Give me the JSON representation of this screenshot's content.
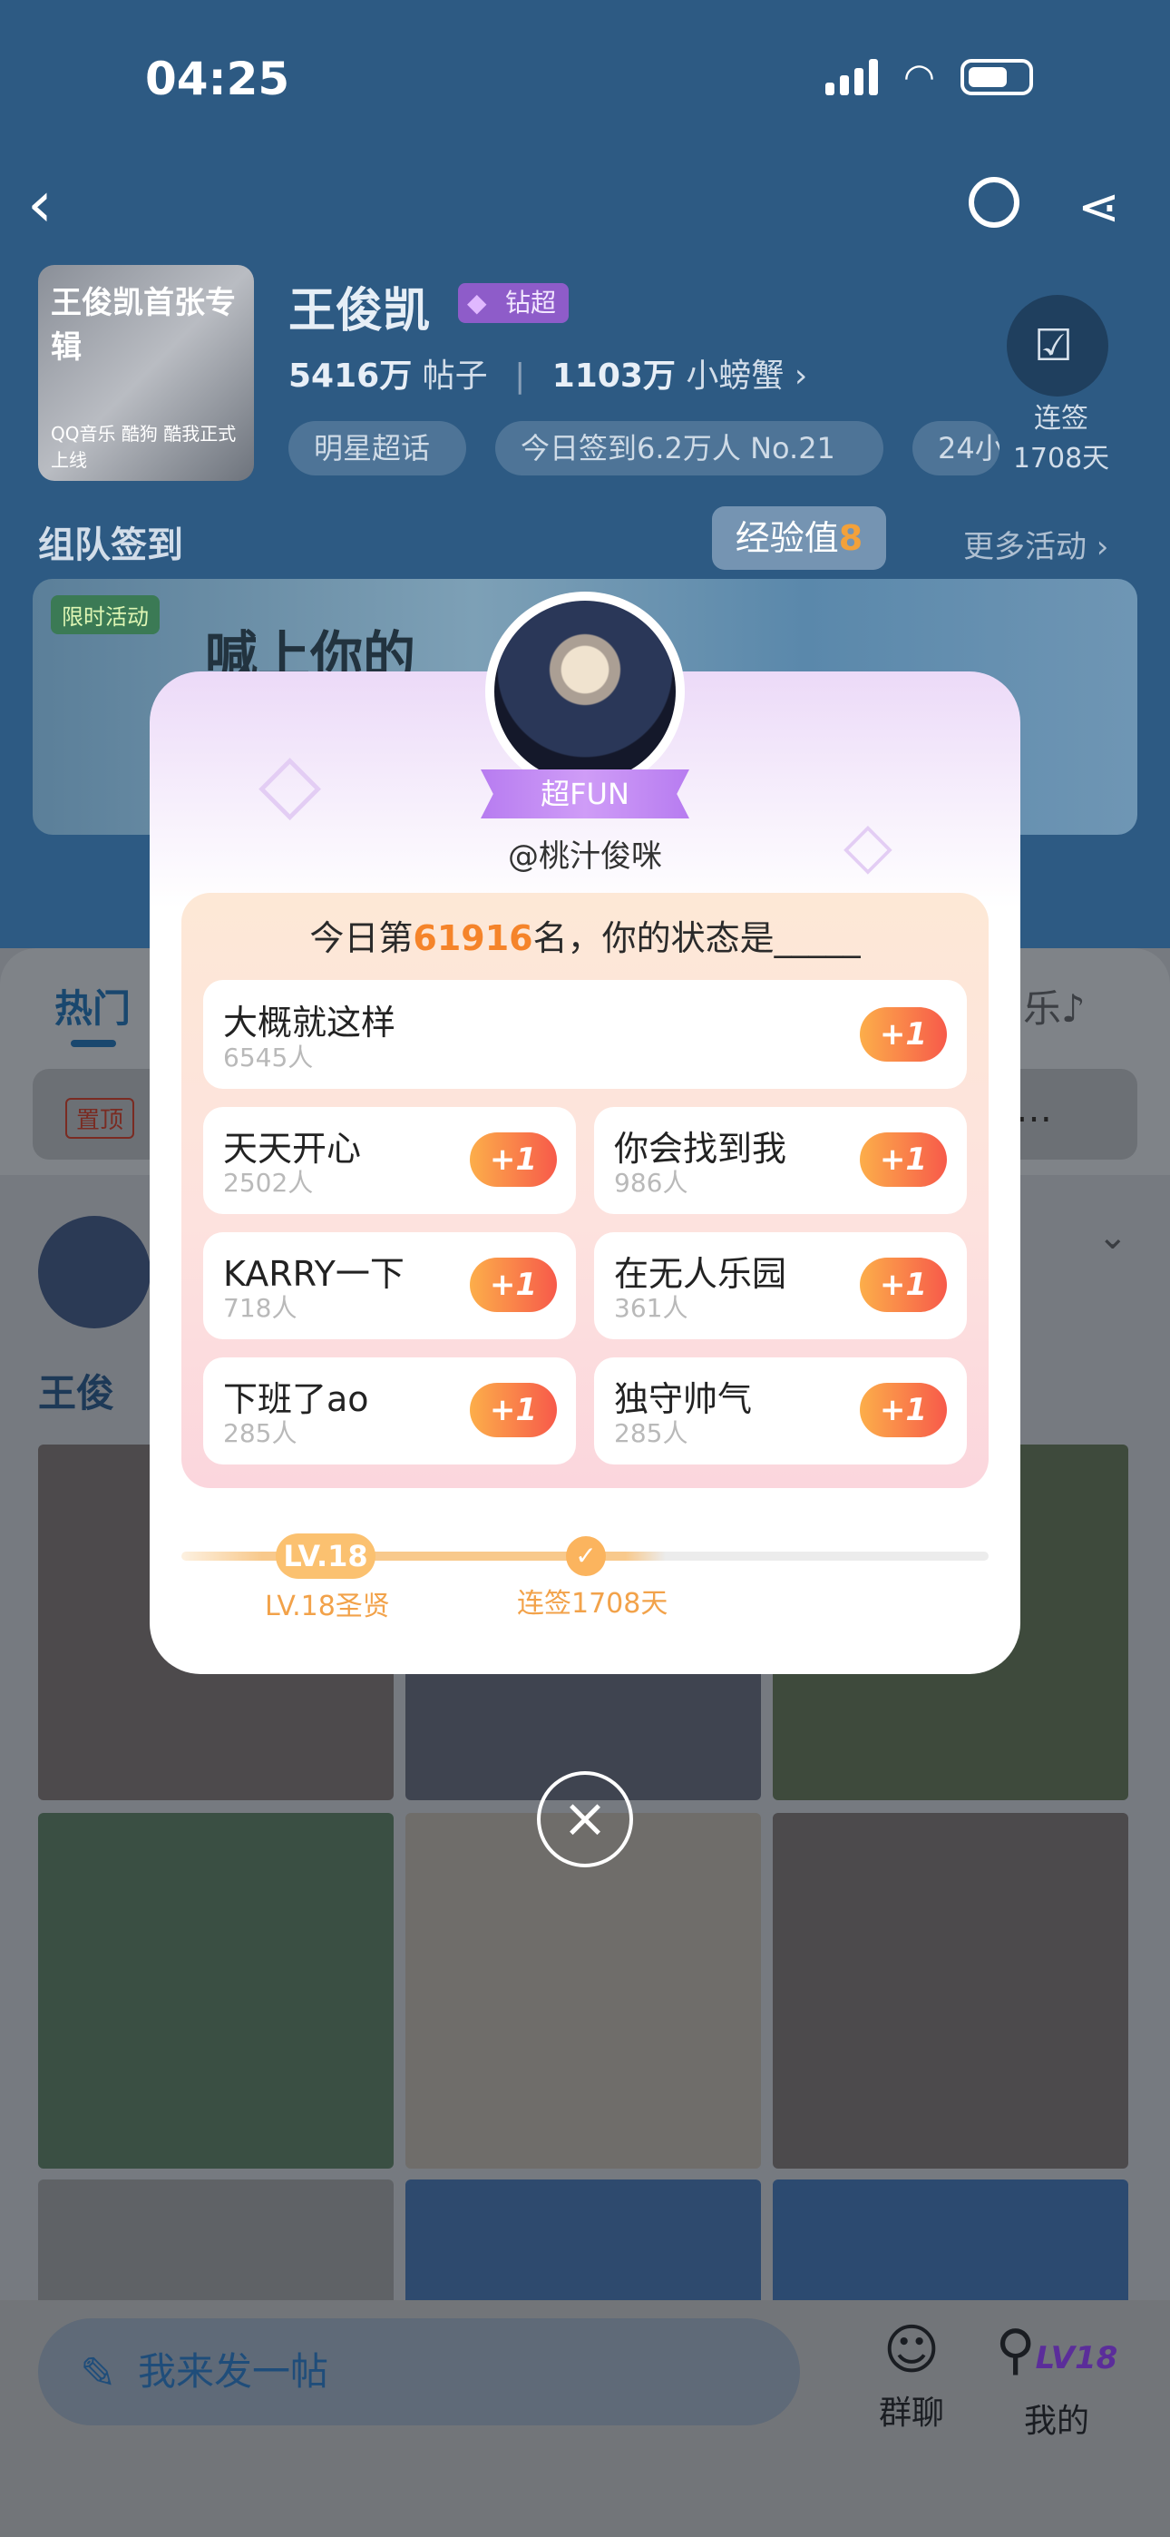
{
  "status_bar": {
    "time": "04:25"
  },
  "header": {
    "cover_title": "王俊凯首张专辑",
    "cover_subtitle": "QQ音乐 酷狗 酷我正式上线",
    "star_name": "王俊凯",
    "badge": "钻超",
    "posts_count": "5416万",
    "posts_label": "帖子",
    "fans_count": "1103万",
    "fans_label": "小螃蟹",
    "tags": [
      "明星超话",
      "今日签到6.2万人 No.21",
      "24小"
    ],
    "sign_label": "连签",
    "sign_days": "1708天",
    "team_title": "组队签到",
    "exp_label": "经验值",
    "exp_value": "8",
    "more_activity": "更多活动",
    "banner_badge": "限时活动",
    "banner_text": "喊上你的"
  },
  "feed": {
    "tab_hot": "热门",
    "tab_right": "乐♪",
    "pin_tag": "置顶",
    "poster_name": "王俊"
  },
  "bottom_bar": {
    "post_placeholder": "我来发一帖",
    "group_chat": "群聊",
    "mine": "我的",
    "level_tag": "LV18"
  },
  "modal": {
    "ribbon": "超FUN",
    "handle": "@桃汁俊咪",
    "title_prefix": "今日第",
    "rank": "61916",
    "title_suffix": "名，你的状态是_____",
    "plus_label": "+1",
    "options": [
      {
        "label": "大概就这样",
        "count": "6545人"
      },
      {
        "label": "天天开心",
        "count": "2502人"
      },
      {
        "label": "你会找到我",
        "count": "986人"
      },
      {
        "label": "KARRY一下",
        "count": "718人"
      },
      {
        "label": "在无人乐园",
        "count": "361人"
      },
      {
        "label": "下班了ao",
        "count": "285人"
      },
      {
        "label": "独守帅气",
        "count": "285人"
      }
    ],
    "level_pill": "LV.18",
    "level_label": "LV.18圣贤",
    "streak_label": "连签1708天",
    "close_icon": "×"
  },
  "colors": {
    "accent_orange": "#f5842a",
    "brand_blue": "#1f4d7a",
    "purple": "#b77cf0"
  }
}
